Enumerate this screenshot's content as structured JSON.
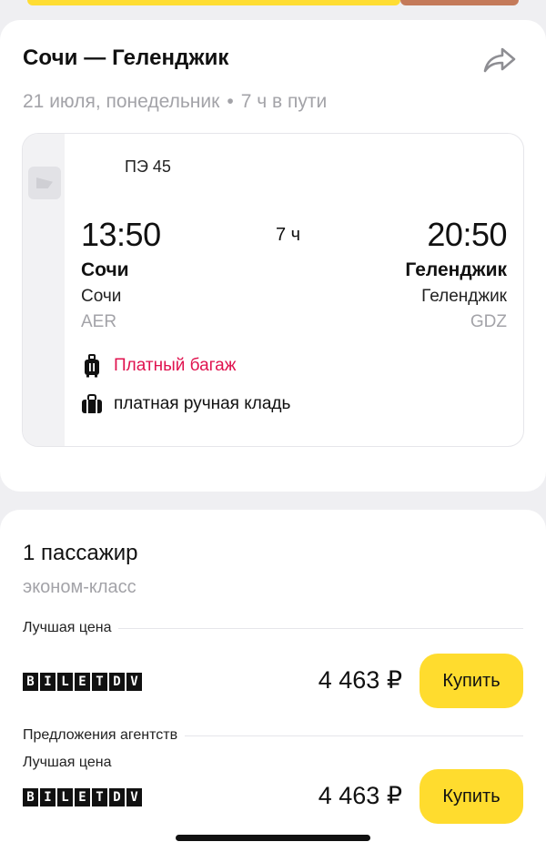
{
  "route": {
    "title": "Сочи — Геленджик",
    "date": "21 июля, понедельник",
    "travel_time": "7 ч в пути"
  },
  "flight": {
    "number": "ПЭ 45",
    "departure_time": "13:50",
    "arrival_time": "20:50",
    "duration": "7 ч",
    "departure_city": "Сочи",
    "arrival_city": "Геленджик",
    "departure_airport": "Сочи",
    "arrival_airport": "Геленджик",
    "departure_code": "AER",
    "arrival_code": "GDZ",
    "baggage": "Платный багаж",
    "hand_luggage": "платная ручная кладь"
  },
  "passengers": {
    "title": "1 пассажир",
    "class": "эконом-класс"
  },
  "offers": {
    "best_price_label": "Лучшая цена",
    "agency_offers_label": "Предложения агентств",
    "items": [
      {
        "seller": "BILETDV",
        "price": "4 463 ₽",
        "buy_label": "Купить"
      },
      {
        "seller": "BILETDV",
        "price": "4 463 ₽",
        "buy_label": "Купить"
      }
    ]
  },
  "colors": {
    "accent_yellow": "#ffdc2e",
    "paid_red": "#e0134f",
    "muted_gray": "#a3a3a8"
  }
}
